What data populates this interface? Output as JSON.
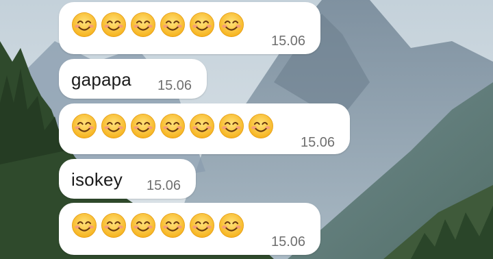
{
  "messages": [
    {
      "type": "emoji",
      "emoji": "smiling-face-with-smiling-eyes",
      "count": 6,
      "time": "15.06"
    },
    {
      "type": "text",
      "text": "gapapa",
      "time": "15.06"
    },
    {
      "type": "emoji",
      "emoji": "smiling-face-with-smiling-eyes",
      "count": 7,
      "time": "15.06"
    },
    {
      "type": "text",
      "text": "isokey",
      "time": "15.06"
    },
    {
      "type": "emoji",
      "emoji": "smiling-face-with-smiling-eyes",
      "count": 6,
      "time": "15.06"
    }
  ],
  "colors": {
    "bubble": "#ffffff",
    "timestamp": "#6f6f6f",
    "text": "#1b1b1b",
    "sky": "#cdd9e0",
    "mountain": "#8fa2b3",
    "forest": "#2f4a2c"
  }
}
